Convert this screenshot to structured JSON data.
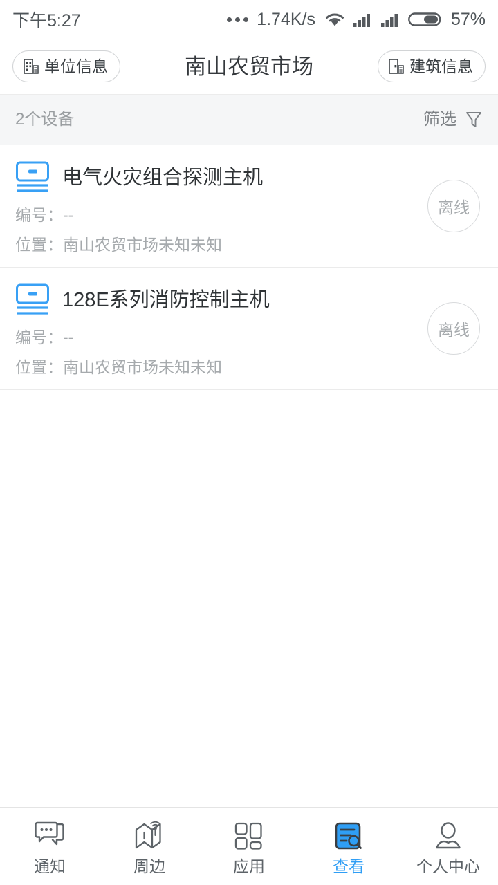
{
  "status_bar": {
    "time": "下午5:27",
    "net_speed": "1.74K/s",
    "battery_percent": "57%",
    "more_icon": "more-dots-icon",
    "wifi_icon": "wifi-icon",
    "signal_icon_1": "cellular-signal-icon",
    "signal_icon_2": "cellular-signal-icon",
    "battery_icon": "battery-icon"
  },
  "header": {
    "title": "南山农贸市场",
    "left_button": {
      "label": "单位信息",
      "icon": "building-icon"
    },
    "right_button": {
      "label": "建筑信息",
      "icon": "building-icon"
    }
  },
  "filter_bar": {
    "count_label": "2个设备",
    "filter_label": "筛选",
    "filter_icon": "funnel-icon"
  },
  "devices": [
    {
      "name": "电气火灾组合探测主机",
      "icon": "device-host-icon",
      "code_label": "编号：--",
      "location_label": "位置：南山农贸市场未知未知",
      "status": "离线"
    },
    {
      "name": "128E系列消防控制主机",
      "icon": "device-host-icon",
      "code_label": "编号：--",
      "location_label": "位置：南山农贸市场未知未知",
      "status": "离线"
    }
  ],
  "bottom_nav": {
    "active_index": 3,
    "items": [
      {
        "label": "通知",
        "icon": "chat-bubbles-icon"
      },
      {
        "label": "周边",
        "icon": "map-radar-icon"
      },
      {
        "label": "应用",
        "icon": "grid-apps-icon"
      },
      {
        "label": "查看",
        "icon": "document-search-icon"
      },
      {
        "label": "个人中心",
        "icon": "person-icon"
      }
    ]
  },
  "colors": {
    "accent": "#2f9ef5",
    "device_icon": "#38a0f5",
    "text_primary": "#2f3336",
    "text_muted": "#a6aaad",
    "filter_bg": "#f5f6f7",
    "divider": "#ebebeb"
  }
}
